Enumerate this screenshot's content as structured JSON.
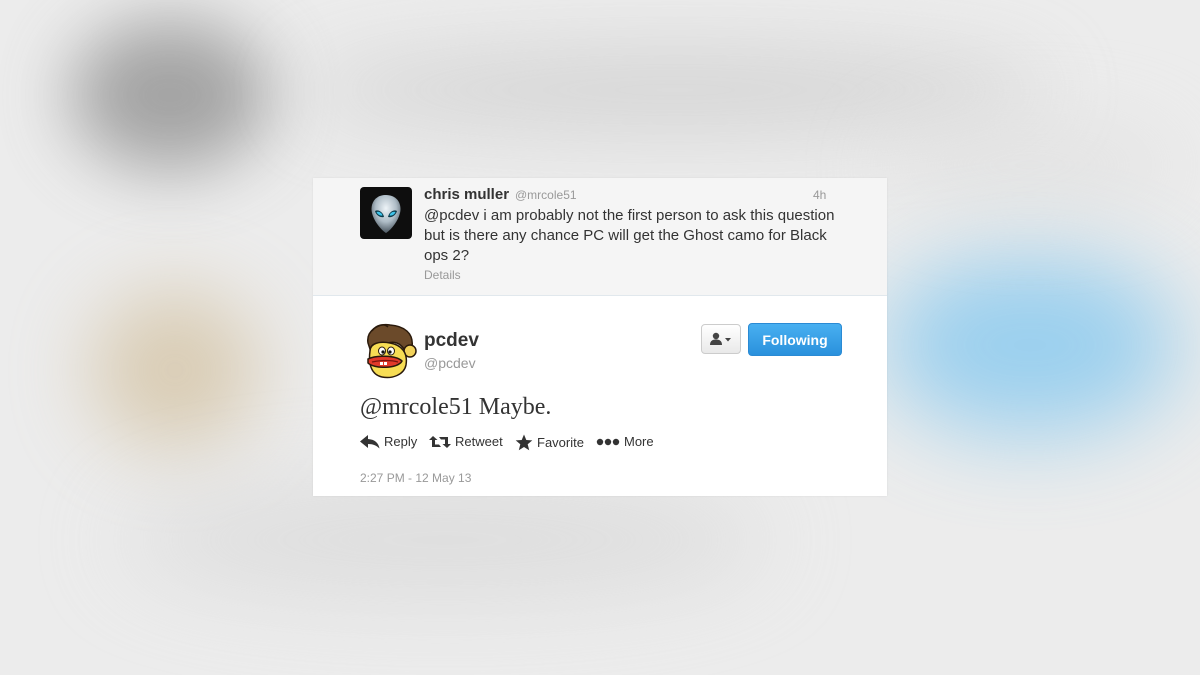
{
  "original_tweet": {
    "name": "chris muller",
    "handle": "@mrcole51",
    "time": "4h",
    "text": "@pcdev i am probably not the first person to ask this question but is there any chance PC will get the Ghost camo for Black ops 2?",
    "details_label": "Details",
    "avatar_icon": "alien-head-icon"
  },
  "reply_tweet": {
    "name": "pcdev",
    "handle": "@pcdev",
    "text": "@mrcole51 Maybe.",
    "timestamp": "2:27 PM - 12 May 13",
    "avatar_icon": "cartoon-duck-avatar"
  },
  "buttons": {
    "user_dropdown_icon": "user-icon",
    "following_label": "Following"
  },
  "actions": {
    "reply": "Reply",
    "retweet": "Retweet",
    "favorite": "Favorite",
    "more": "More"
  },
  "colors": {
    "follow_button": "#2a91dc",
    "text": "#333333",
    "muted": "#999999"
  }
}
